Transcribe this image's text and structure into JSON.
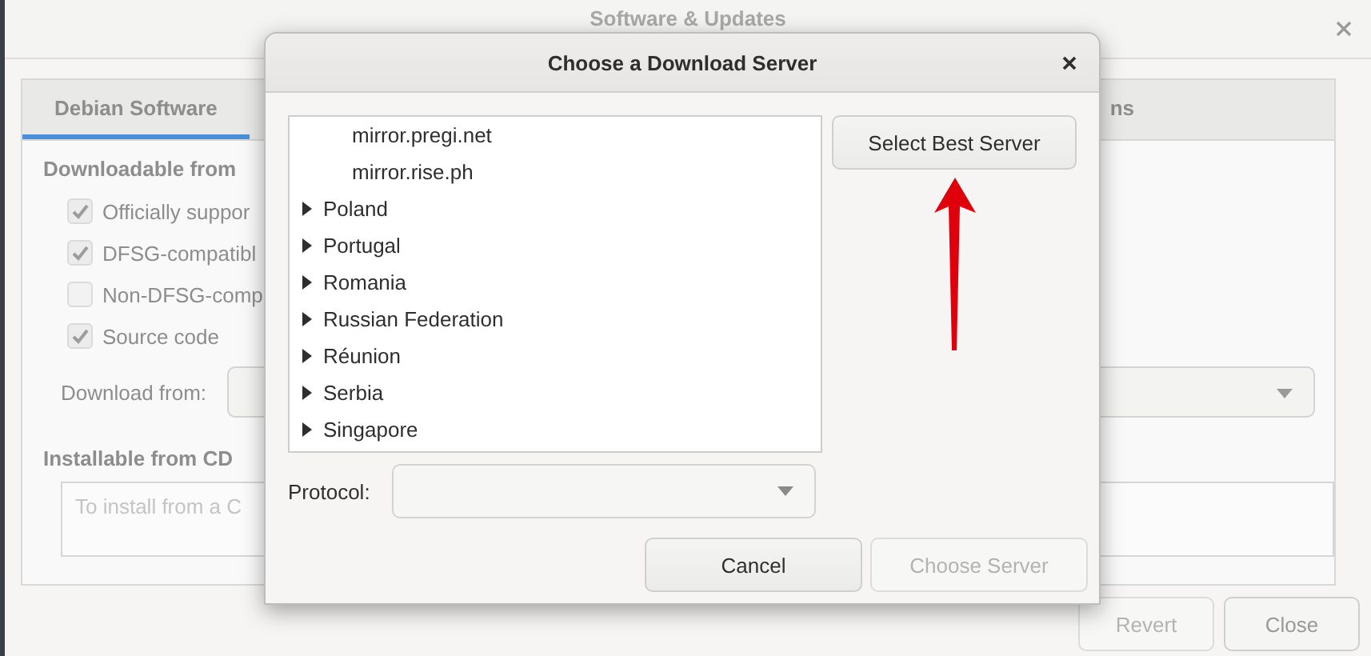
{
  "window": {
    "title": "Software & Updates"
  },
  "tabs": [
    {
      "label": "Debian Software",
      "selected": true
    },
    {
      "label": "ns",
      "selected": false
    }
  ],
  "downloadable": {
    "heading": "Downloadable from",
    "options": [
      {
        "label": "Officially suppor",
        "checked": true
      },
      {
        "label": "DFSG-compatibl",
        "checked": true
      },
      {
        "label": "Non-DFSG-comp",
        "checked": false
      },
      {
        "label": "Source code",
        "checked": true
      }
    ],
    "download_from_label": "Download from:"
  },
  "installable": {
    "heading": "Installable from CD",
    "text": "To install from a C"
  },
  "buttons": [
    {
      "label": "Revert",
      "disabled": true
    },
    {
      "label": "Close",
      "disabled": false
    }
  ],
  "dialog": {
    "title": "Choose a Download Server",
    "servers": [
      {
        "kind": "mirror",
        "label": "mirror.pregi.net"
      },
      {
        "kind": "mirror",
        "label": "mirror.rise.ph"
      },
      {
        "kind": "country",
        "label": "Poland",
        "expanded": false
      },
      {
        "kind": "country",
        "label": "Portugal",
        "expanded": false
      },
      {
        "kind": "country",
        "label": "Romania",
        "expanded": false
      },
      {
        "kind": "country",
        "label": "Russian Federation",
        "expanded": false
      },
      {
        "kind": "country",
        "label": "Réunion",
        "expanded": false
      },
      {
        "kind": "country",
        "label": "Serbia",
        "expanded": false
      },
      {
        "kind": "country",
        "label": "Singapore",
        "expanded": false
      }
    ],
    "best_button": "Select Best Server",
    "protocol_label": "Protocol:",
    "buttons": [
      {
        "label": "Cancel",
        "disabled": false
      },
      {
        "label": "Choose Server",
        "disabled": true
      }
    ]
  }
}
